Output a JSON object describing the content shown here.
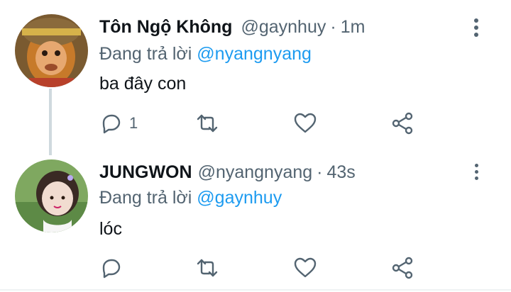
{
  "tweets": [
    {
      "display_name": "Tôn Ngộ Không",
      "handle": "@gaynhuy",
      "time": "1m",
      "reply_prefix": "Đang trả lời",
      "reply_mention": "@nyangnyang",
      "text": "ba đây con",
      "reply_count": "1"
    },
    {
      "display_name": "JUNGWON",
      "handle": "@nyangnyang",
      "time": "43s",
      "reply_prefix": "Đang trả lời",
      "reply_mention": "@gaynhuy",
      "text": "lóc",
      "reply_count": ""
    }
  ],
  "separator": "·",
  "colors": {
    "accent": "#1d9bf0",
    "secondary": "#536471",
    "text": "#0f1419"
  },
  "icons": [
    "reply-icon",
    "retweet-icon",
    "like-icon",
    "share-icon",
    "more-icon"
  ]
}
